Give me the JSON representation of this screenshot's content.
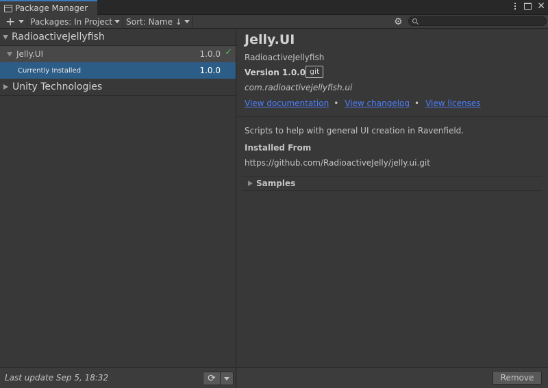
{
  "window": {
    "tab_title": "Package Manager",
    "icons": [
      "package-icon",
      "kebab-menu-icon",
      "maximize-icon",
      "close-icon"
    ]
  },
  "toolbar": {
    "add_label": "+",
    "packages_filter": "Packages: In Project",
    "sort": "Sort: Name ↓",
    "search_placeholder": "",
    "icons": [
      "gear-icon",
      "search-icon"
    ]
  },
  "package_list": {
    "groups": [
      {
        "name": "RadioactiveJellyfish",
        "expanded": true,
        "packages": [
          {
            "name": "Jelly.UI",
            "version": "1.0.0",
            "installed": true,
            "sub_label": "Currently Installed",
            "sub_version": "1.0.0"
          }
        ]
      },
      {
        "name": "Unity Technologies",
        "expanded": false
      }
    ],
    "footer": {
      "last_update": "Last update Sep 5, 18:32",
      "refresh_icon": "refresh-icon"
    }
  },
  "details": {
    "title": "Jelly.UI",
    "author": "RadioactiveJellyfish",
    "version_text": "Version 1.0.0",
    "source_badge": "git",
    "package_id": "com.radioactivejellyfish.ui",
    "links": {
      "documentation": "View documentation",
      "changelog": "View changelog",
      "licenses": "View licenses",
      "separator": "•"
    },
    "description": "Scripts to help with general UI creation in Ravenfield.",
    "installed_from_label": "Installed From",
    "installed_from_url": "https://github.com/RadioactiveJelly/jelly.ui.git",
    "samples_label": "Samples",
    "remove_label": "Remove"
  },
  "colors": {
    "accent_tab": "#3a79bb",
    "selection": "#2c5d87",
    "link": "#4c7efe",
    "check": "#58b858"
  }
}
